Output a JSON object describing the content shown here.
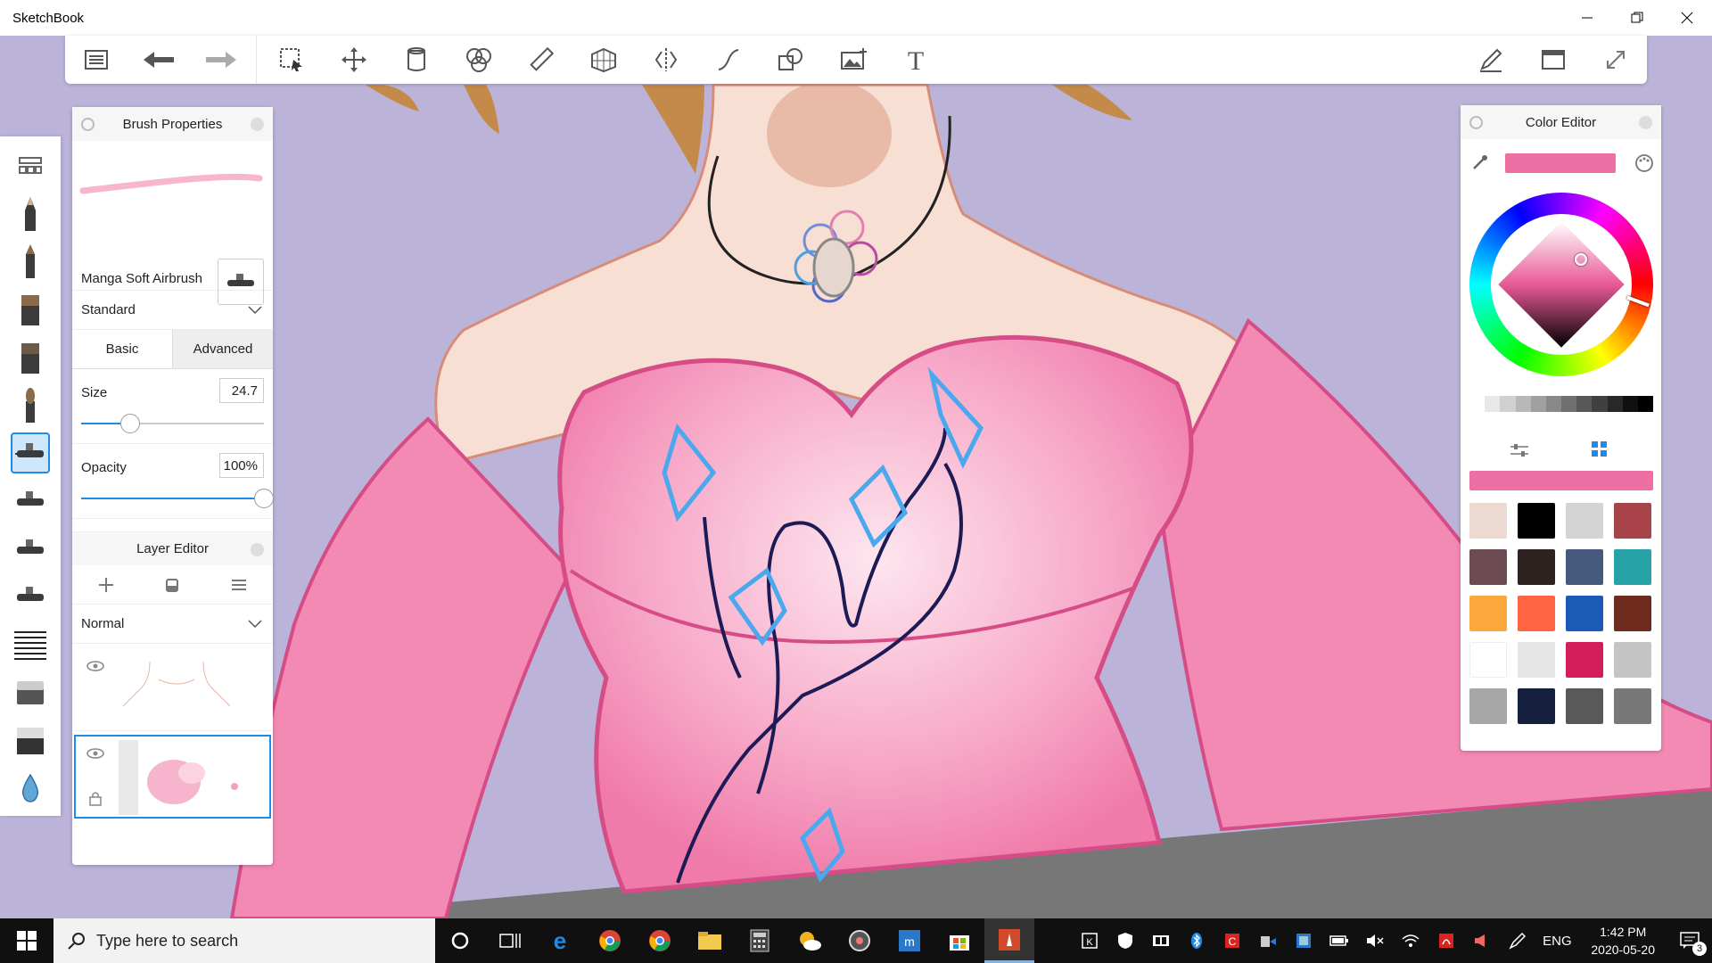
{
  "window": {
    "title": "SketchBook"
  },
  "toolbar": {
    "items": [
      "menu-icon",
      "undo-icon",
      "redo-icon",
      "select-icon",
      "move-icon",
      "fill-icon",
      "blend-icon",
      "ruler-icon",
      "perspective-icon",
      "symmetry-icon",
      "stroke-icon",
      "shape-icon",
      "image-icon",
      "text-icon"
    ],
    "right_items": [
      "pen-icon",
      "window-icon",
      "fullscreen-icon"
    ]
  },
  "brush_panel": {
    "title": "Brush Properties",
    "brush_name": "Manga Soft Airbrush",
    "preset": "Standard",
    "tabs": [
      "Basic",
      "Advanced"
    ],
    "size_label": "Size",
    "size_value": "24.7",
    "size_fraction": 0.27,
    "opacity_label": "Opacity",
    "opacity_value": "100%",
    "opacity_fraction": 1.0
  },
  "layer_panel": {
    "title": "Layer Editor",
    "blend_mode": "Normal"
  },
  "color_panel": {
    "title": "Color Editor",
    "current_color": "#ee6fa4",
    "swatches": [
      "#ecd9d2",
      "#000000",
      "#d4d4d4",
      "#a8434a",
      "#6d4b52",
      "#2e2320",
      "#45597c",
      "#27a3a7",
      "#fba73c",
      "#ff6443",
      "#1c5ab8",
      "#6e2b1e",
      "#ffffff",
      "#e5e5e5",
      "#d41e5c",
      "#c5c5c5",
      "#a6a6a6",
      "#15203f",
      "#595959",
      "#787878"
    ],
    "grays": [
      "#ffffff",
      "#e8e8e8",
      "#d0d0d0",
      "#b8b8b8",
      "#a0a0a0",
      "#888888",
      "#707070",
      "#585858",
      "#404040",
      "#282828",
      "#101010",
      "#000000"
    ]
  },
  "taskbar": {
    "search_placeholder": "Type here to search",
    "language": "ENG",
    "time": "1:42 PM",
    "date": "2020-05-20",
    "notification_count": "3"
  }
}
